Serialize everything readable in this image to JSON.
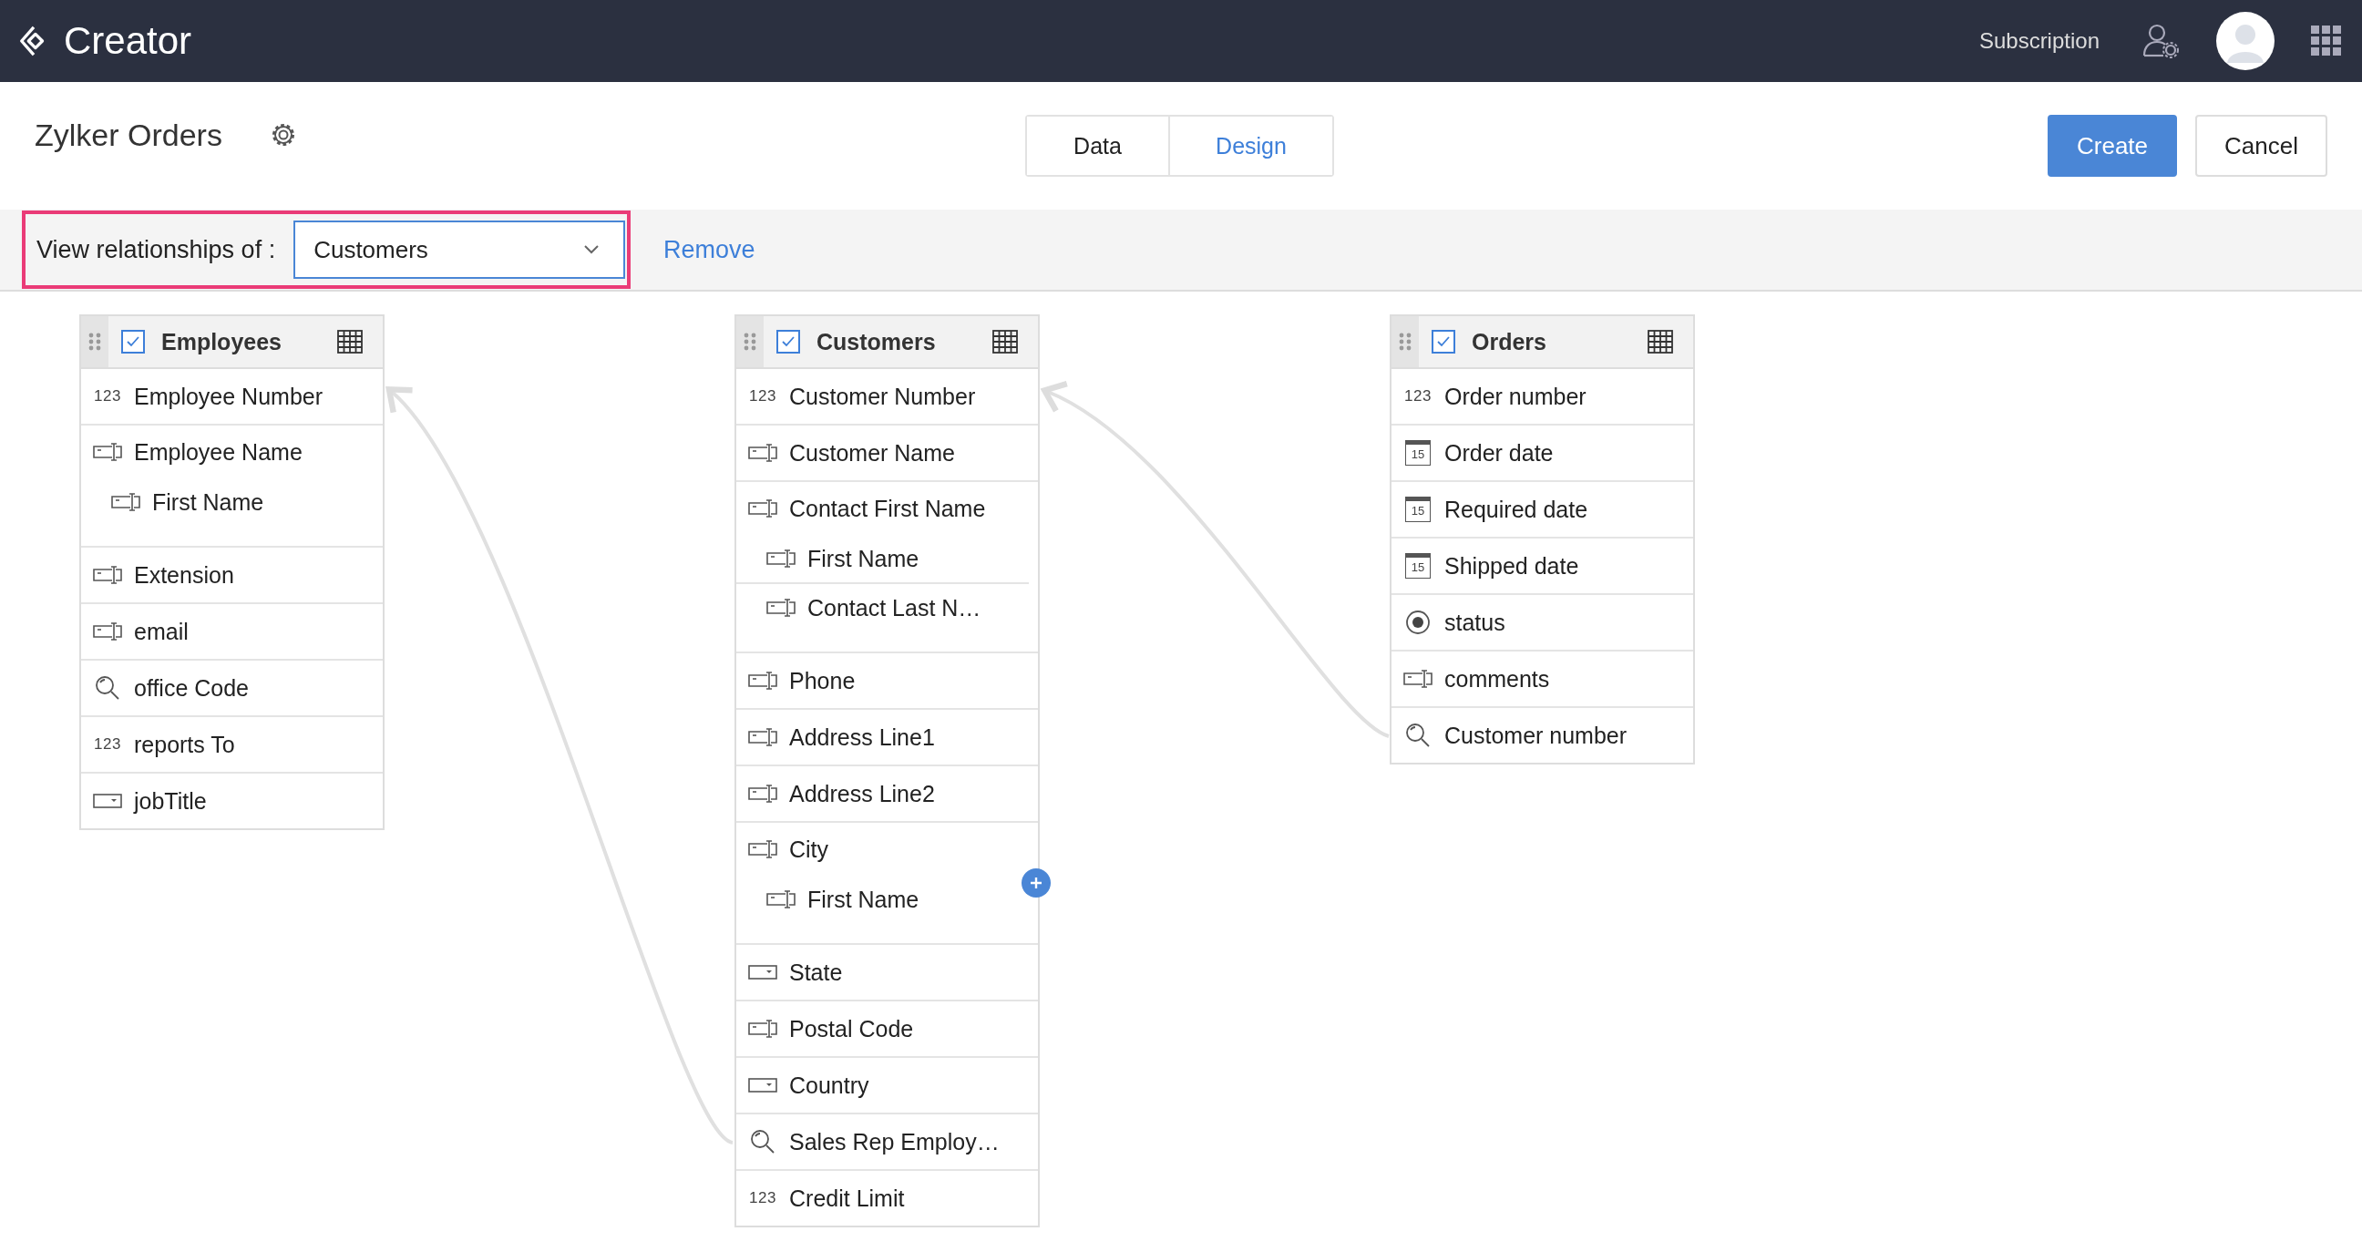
{
  "app": {
    "name": "Creator"
  },
  "topbar": {
    "subscription": "Subscription"
  },
  "page": {
    "title": "Zylker Orders"
  },
  "tabs": [
    {
      "label": "Data",
      "selected": false
    },
    {
      "label": "Design",
      "selected": true
    }
  ],
  "actions": {
    "create": "Create",
    "cancel": "Cancel"
  },
  "filter": {
    "label": "View relationships of :",
    "value": "Customers",
    "remove": "Remove"
  },
  "tables": [
    {
      "name": "Employees",
      "checked": true,
      "fields": [
        {
          "kind": "number",
          "icon_text": "123",
          "label": "Employee Number"
        },
        {
          "kind": "text",
          "label": "Employee Name",
          "children": [
            {
              "kind": "text",
              "label": "First Name"
            }
          ]
        },
        {
          "kind": "text",
          "label": "Extension"
        },
        {
          "kind": "text",
          "label": "email"
        },
        {
          "kind": "lookup",
          "label": "office Code"
        },
        {
          "kind": "number",
          "icon_text": "123",
          "label": "reports To"
        },
        {
          "kind": "dropdown",
          "label": "jobTitle"
        }
      ]
    },
    {
      "name": "Customers",
      "checked": true,
      "fields": [
        {
          "kind": "number",
          "icon_text": "123",
          "label": "Customer Number"
        },
        {
          "kind": "text",
          "label": "Customer Name"
        },
        {
          "kind": "text",
          "label": "Contact First Name",
          "children": [
            {
              "kind": "text",
              "label": "First Name"
            },
            {
              "kind": "text",
              "label": "Contact Last N…"
            }
          ]
        },
        {
          "kind": "text",
          "label": "Phone"
        },
        {
          "kind": "text",
          "label": "Address Line1"
        },
        {
          "kind": "text",
          "label": "Address Line2"
        },
        {
          "kind": "text",
          "label": "City",
          "children": [
            {
              "kind": "text",
              "label": "First Name"
            }
          ]
        },
        {
          "kind": "dropdown",
          "label": "State"
        },
        {
          "kind": "text",
          "label": "Postal Code"
        },
        {
          "kind": "dropdown",
          "label": "Country"
        },
        {
          "kind": "lookup",
          "label": "Sales Rep Employ…"
        },
        {
          "kind": "number",
          "icon_text": "123",
          "label": "Credit Limit"
        }
      ]
    },
    {
      "name": "Orders",
      "checked": true,
      "fields": [
        {
          "kind": "number",
          "icon_text": "123",
          "label": "Order number"
        },
        {
          "kind": "date",
          "icon_text": "15",
          "label": "Order date"
        },
        {
          "kind": "date",
          "icon_text": "15",
          "label": "Required date"
        },
        {
          "kind": "date",
          "icon_text": "15",
          "label": "Shipped date"
        },
        {
          "kind": "radio",
          "label": "status"
        },
        {
          "kind": "text",
          "label": "comments"
        },
        {
          "kind": "lookup",
          "label": "Customer number"
        }
      ]
    }
  ]
}
